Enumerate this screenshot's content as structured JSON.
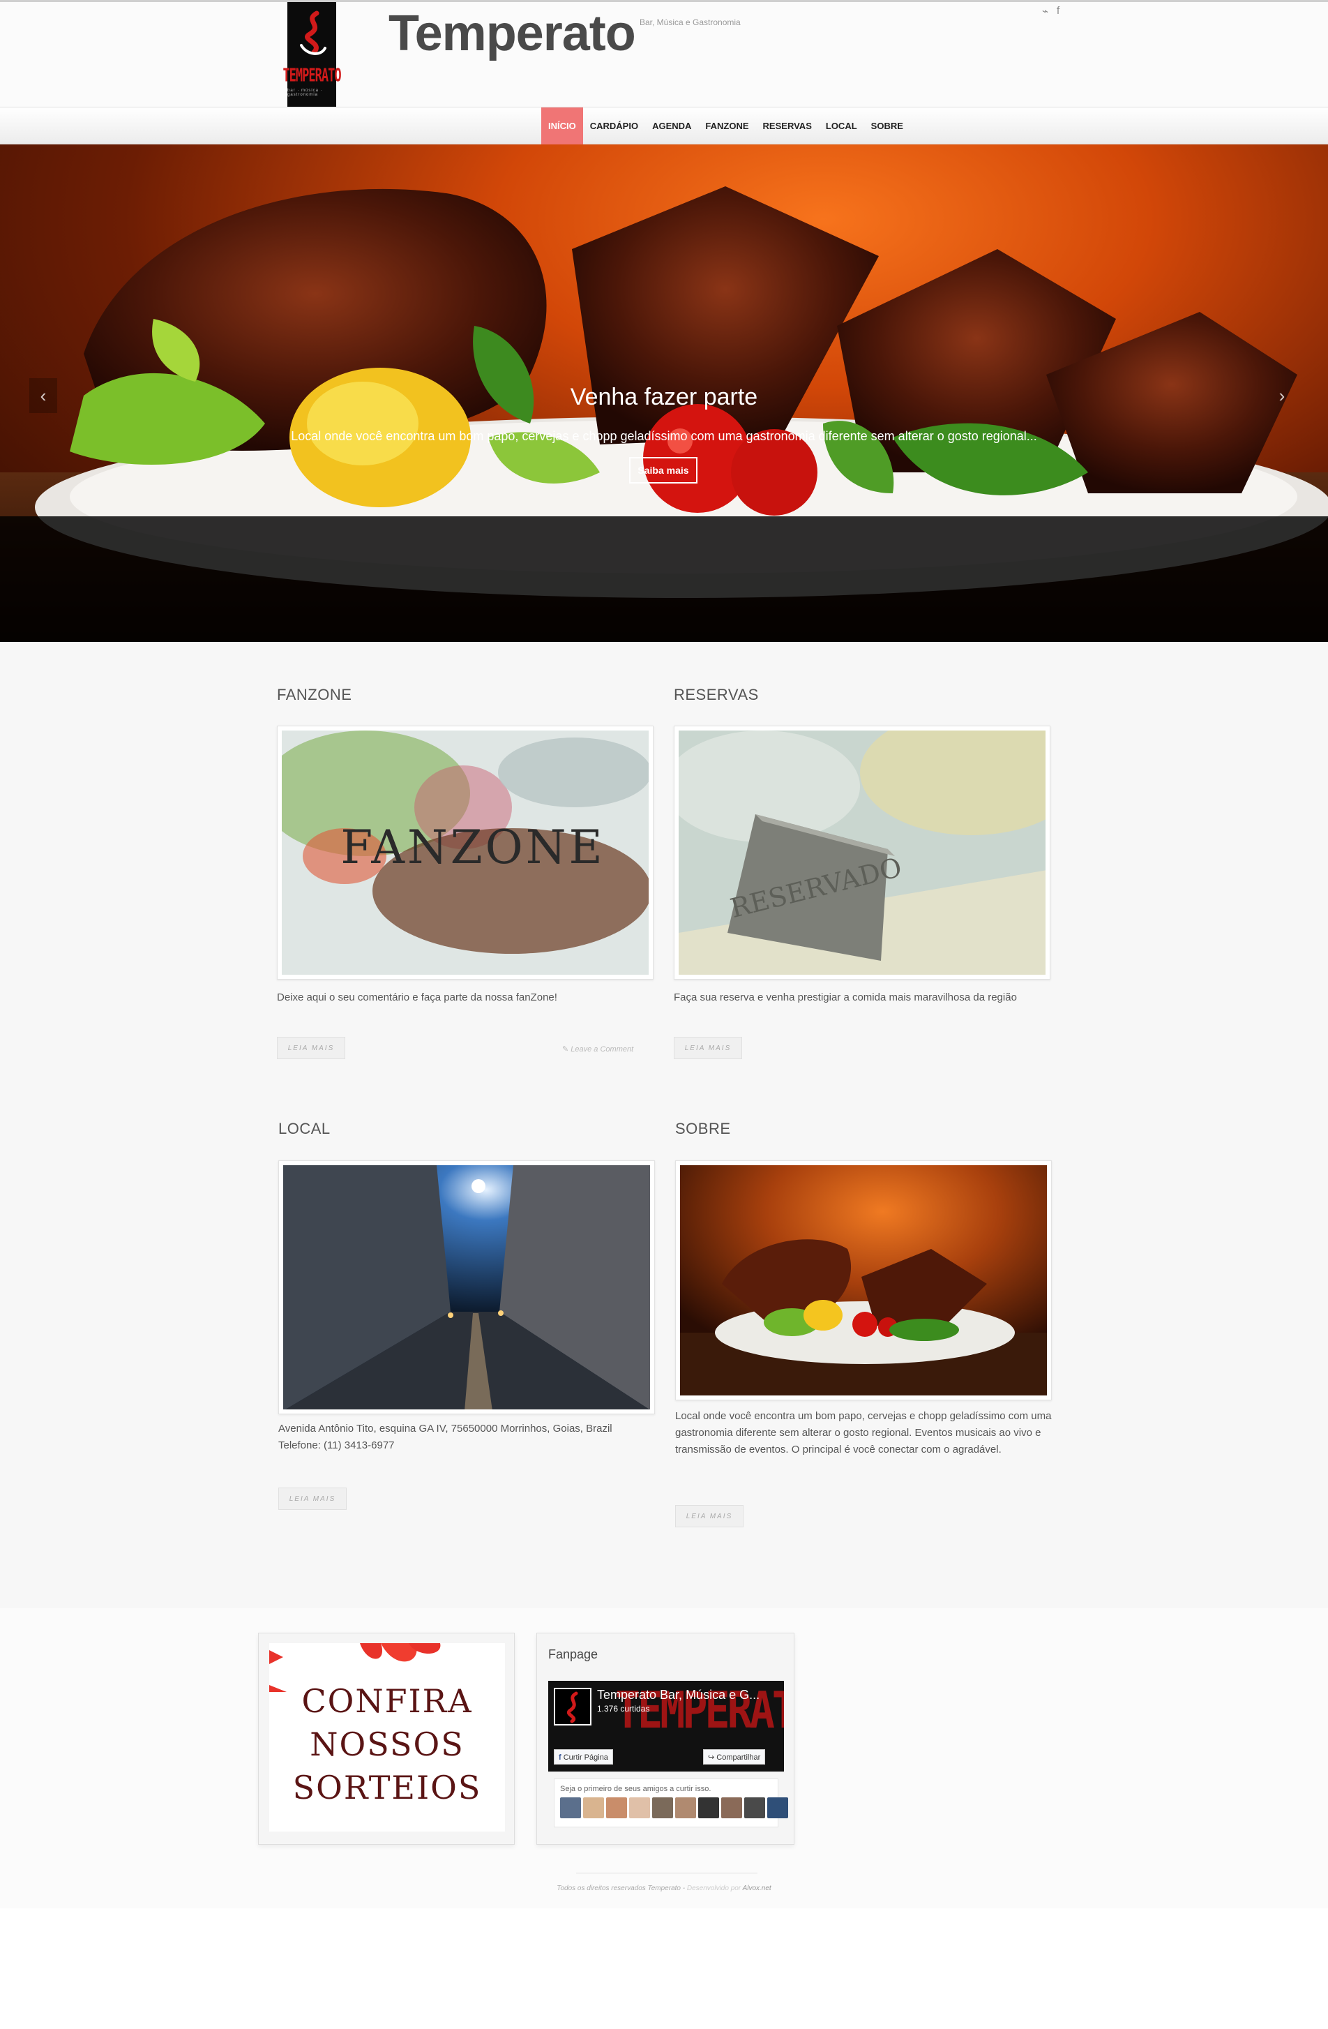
{
  "header": {
    "title": "Temperato",
    "tagline": "Bar, Música e Gastronomia",
    "logo_word": "TEMPERATO",
    "logo_sub": "bar · música · gastronomia",
    "social": [
      {
        "icon": "rss-icon",
        "glyph": "⌁"
      },
      {
        "icon": "facebook-icon",
        "glyph": "f"
      }
    ]
  },
  "nav": {
    "items": [
      "INÍCIO",
      "CARDÁPIO",
      "AGENDA",
      "FANZONE",
      "RESERVAS",
      "LOCAL",
      "SOBRE"
    ],
    "active_index": 0
  },
  "hero": {
    "title": "Venha fazer parte",
    "text": "Local onde você encontra um bom papo, cervejas e chopp geladíssimo com uma gastronomia diferente sem alterar o gosto regional...",
    "button": "Saiba mais",
    "prev_glyph": "‹",
    "next_glyph": "›"
  },
  "sections": {
    "fanzone": {
      "title": "FANZONE",
      "image_word": "FANZONE",
      "text": "Deixe aqui o seu comentário e faça parte da nossa fanZone!",
      "read_more": "LEIA MAIS",
      "comment": "Leave a Comment"
    },
    "reservas": {
      "title": "RESERVAS",
      "image_word": "RESERVADO",
      "text": "Faça sua reserva e venha prestigiar a comida mais maravilhosa da região",
      "read_more": "LEIA MAIS"
    },
    "local": {
      "title": "LOCAL",
      "address": "Avenida Antônio Tito, esquina GA IV, 75650000 Morrinhos, Goias, Brazil",
      "phone": "Telefone: (11) 3413-6977",
      "read_more": "LEIA MAIS"
    },
    "sobre": {
      "title": "SOBRE",
      "text": "Local onde você encontra um bom papo, cervejas e chopp geladíssimo com uma gastronomia diferente sem alterar o gosto regional. Eventos musicais ao vivo e transmissão de eventos. O principal é você conectar com o agradável.",
      "read_more": "LEIA MAIS"
    }
  },
  "widgets": {
    "promo_lines": [
      "CONFIRA",
      "NOSSOS",
      "SORTEIOS"
    ],
    "fanpage": {
      "title": "Fanpage",
      "page_name": "Temperato Bar, Música e G...",
      "likes": "1.376 curtidas",
      "like_button": "Curtir Página",
      "share_button": "Compartilhar",
      "friends_text": "Seja o primeiro de seus amigos a curtir isso."
    }
  },
  "footer": {
    "rights": "Todos os direitos reservados Temperato",
    "dev_prefix": "Desenvolvido por",
    "dev_link": "Alvox.net"
  },
  "colors": {
    "accent": "#f07575",
    "logo_red": "#d11a1a",
    "caption_bg": "#000000"
  }
}
